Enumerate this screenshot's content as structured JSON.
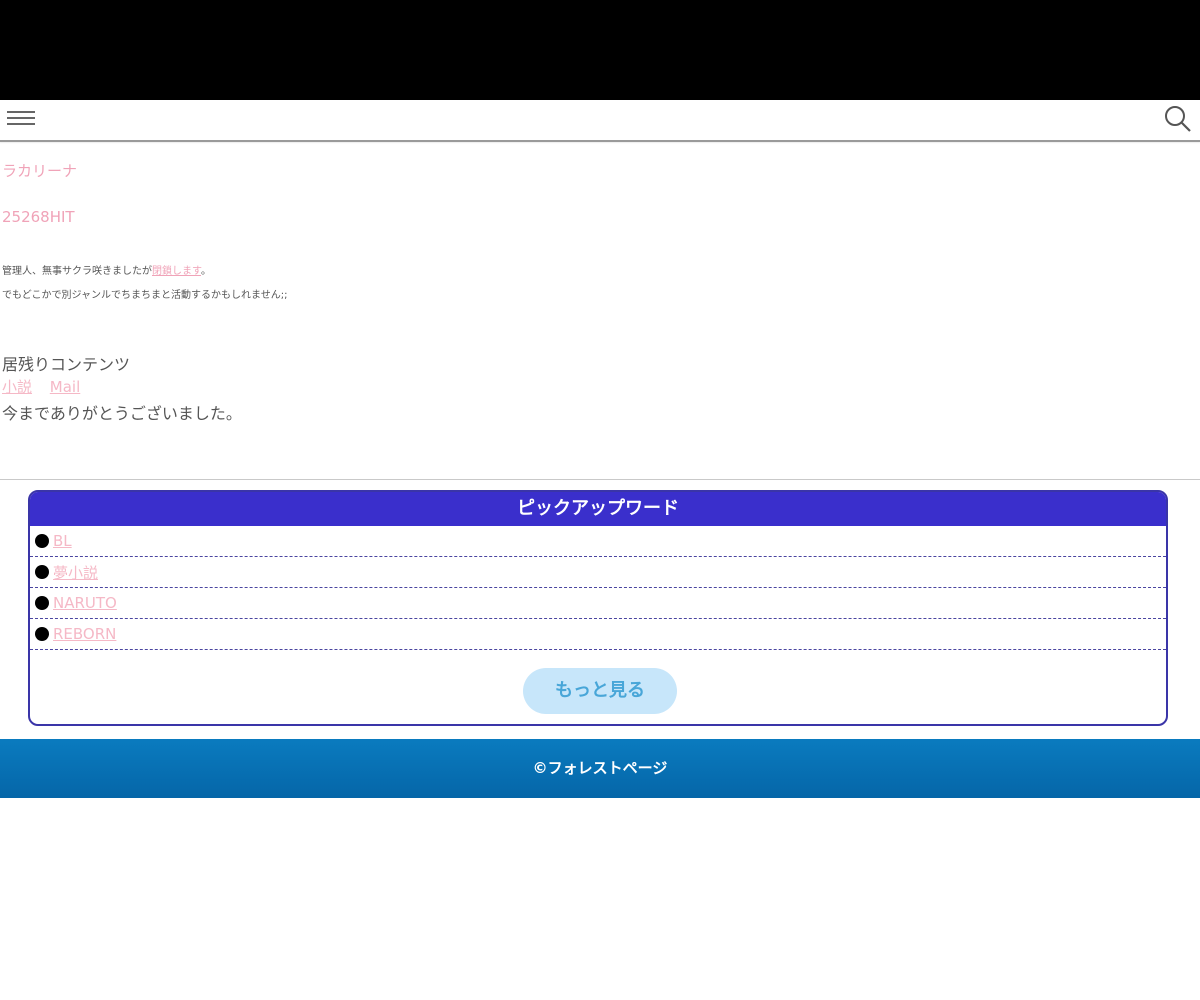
{
  "header": {
    "menu_icon": "hamburger-menu-icon",
    "search_icon": "search-icon"
  },
  "main": {
    "site_title": "ラカリーナ",
    "hit_counter": "25268HIT",
    "note_line1_prefix": "管理人、無事サクラ咲きましたが",
    "note_line1_link": "閉鎖します",
    "note_line1_suffix": "。",
    "note_line2": "でもどこかで別ジャンルでちまちまと活動するかもしれません;;",
    "remain_heading": "居残りコンテンツ",
    "remain_links": [
      "小説",
      "Mail"
    ],
    "thanks": "今までありがとうございました。"
  },
  "pickup": {
    "title": "ピックアップワード",
    "items": [
      "BL",
      "夢小説",
      "NARUTO",
      "REBORN"
    ],
    "more_label": "もっと見る"
  },
  "footer": {
    "copyright": "©フォレストページ"
  },
  "colors": {
    "accent_link": "#f0a3b8",
    "pickup_header": "#3a2fcc",
    "footer": "#0a7bbf"
  }
}
